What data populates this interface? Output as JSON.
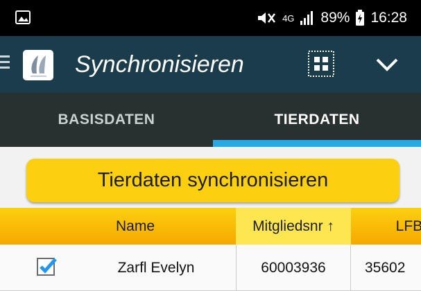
{
  "status_bar": {
    "network": "4G",
    "battery": "89%",
    "time": "16:28"
  },
  "app_bar": {
    "title": "Synchronisieren"
  },
  "tabs": [
    {
      "label": "BASISDATEN",
      "active": false
    },
    {
      "label": "TIERDATEN",
      "active": true
    }
  ],
  "sync_button": {
    "label": "Tierdaten synchronisieren"
  },
  "table": {
    "headers": {
      "name": "Name",
      "mitgliedsnr": "Mitgliedsnr ↑",
      "lfbis": "LFBI"
    },
    "rows": [
      {
        "checked": true,
        "name": "Zarfl Evelyn",
        "mitgliedsnr": "60003936",
        "lfbis": "35602"
      }
    ]
  },
  "colors": {
    "status_bar": "#000000",
    "app_bar": "#1b3c4b",
    "tab_bar": "#28312f",
    "tab_indicator": "#29a9e1",
    "accent_yellow": "#fcd00f",
    "checkbox_blue": "#2196f3"
  },
  "icons": [
    "image-icon",
    "mute-icon",
    "signal-icon",
    "battery-icon",
    "menu-icon",
    "app-logo-icon",
    "grid-icon",
    "chevron-down-icon",
    "checkbox-checked-icon"
  ]
}
